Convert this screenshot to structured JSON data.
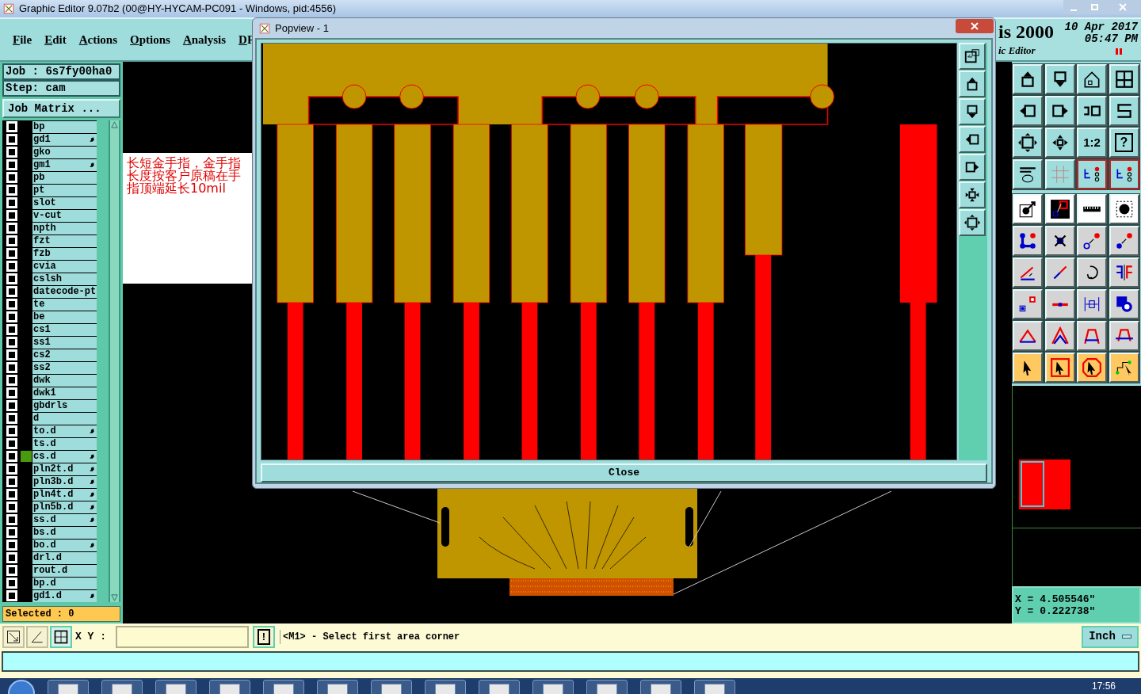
{
  "window": {
    "title": "Graphic Editor 9.07b2 (00@HY-HYCAM-PC091 - Windows, pid:4556)"
  },
  "menu": [
    "File",
    "Edit",
    "Actions",
    "Options",
    "Analysis",
    "DF"
  ],
  "header": {
    "product": "is 2000",
    "date": "10 Apr 2017",
    "time": "05:47 PM",
    "subtitle": "ic Editor"
  },
  "job": {
    "job_label": "Job : 6s7fy00ha0",
    "step_label": "Step: cam",
    "matrix_button": "Job Matrix ..."
  },
  "layers": [
    {
      "name": "bp",
      "checked": false,
      "marked": false,
      "highlighted": false
    },
    {
      "name": "gd1",
      "checked": false,
      "marked": true,
      "highlighted": false
    },
    {
      "name": "gko",
      "checked": false,
      "marked": false,
      "highlighted": false
    },
    {
      "name": "gm1",
      "checked": false,
      "marked": true,
      "highlighted": false
    },
    {
      "name": "pb",
      "checked": false,
      "marked": false,
      "highlighted": false
    },
    {
      "name": "pt",
      "checked": false,
      "marked": false,
      "highlighted": false
    },
    {
      "name": "slot",
      "checked": false,
      "marked": false,
      "highlighted": false
    },
    {
      "name": "v-cut",
      "checked": false,
      "marked": false,
      "highlighted": false
    },
    {
      "name": "npth",
      "checked": false,
      "marked": false,
      "highlighted": false
    },
    {
      "name": "fzt",
      "checked": false,
      "marked": false,
      "highlighted": false
    },
    {
      "name": "fzb",
      "checked": false,
      "marked": false,
      "highlighted": false
    },
    {
      "name": "cvia",
      "checked": false,
      "marked": false,
      "highlighted": false
    },
    {
      "name": "cslsh",
      "checked": false,
      "marked": false,
      "highlighted": false
    },
    {
      "name": "datecode-pt",
      "checked": false,
      "marked": false,
      "highlighted": false
    },
    {
      "name": "te",
      "checked": false,
      "marked": false,
      "highlighted": false
    },
    {
      "name": "be",
      "checked": false,
      "marked": false,
      "highlighted": false
    },
    {
      "name": "cs1",
      "checked": false,
      "marked": false,
      "highlighted": false
    },
    {
      "name": "ss1",
      "checked": false,
      "marked": false,
      "highlighted": false
    },
    {
      "name": "cs2",
      "checked": false,
      "marked": false,
      "highlighted": false
    },
    {
      "name": "ss2",
      "checked": false,
      "marked": false,
      "highlighted": false
    },
    {
      "name": "dwk",
      "checked": false,
      "marked": false,
      "highlighted": false
    },
    {
      "name": "dwk1",
      "checked": false,
      "marked": false,
      "highlighted": false
    },
    {
      "name": "gbdrls",
      "checked": false,
      "marked": false,
      "highlighted": false
    },
    {
      "name": "d",
      "checked": false,
      "marked": false,
      "highlighted": false
    },
    {
      "name": "to.d",
      "checked": false,
      "marked": true,
      "highlighted": false
    },
    {
      "name": "ts.d",
      "checked": false,
      "marked": false,
      "highlighted": false
    },
    {
      "name": "cs.d",
      "checked": false,
      "marked": true,
      "highlighted": true
    },
    {
      "name": "pln2t.d",
      "checked": false,
      "marked": true,
      "highlighted": false
    },
    {
      "name": "pln3b.d",
      "checked": false,
      "marked": true,
      "highlighted": false
    },
    {
      "name": "pln4t.d",
      "checked": false,
      "marked": true,
      "highlighted": false
    },
    {
      "name": "pln5b.d",
      "checked": false,
      "marked": true,
      "highlighted": false
    },
    {
      "name": "ss.d",
      "checked": false,
      "marked": true,
      "highlighted": false
    },
    {
      "name": "bs.d",
      "checked": false,
      "marked": false,
      "highlighted": false
    },
    {
      "name": "bo.d",
      "checked": false,
      "marked": true,
      "highlighted": false
    },
    {
      "name": "drl.d",
      "checked": false,
      "marked": false,
      "highlighted": false
    },
    {
      "name": "rout.d",
      "checked": false,
      "marked": false,
      "highlighted": false
    },
    {
      "name": "bp.d",
      "checked": false,
      "marked": false,
      "highlighted": false
    },
    {
      "name": "gd1.d",
      "checked": false,
      "marked": true,
      "highlighted": false
    }
  ],
  "selected_count": "Selected : 0",
  "note": "长短金手指，金手指长度按客户原稿在手指顶端延长10mil",
  "popview": {
    "title": "Popview - 1",
    "close_button": "Close"
  },
  "toolbar": {
    "ratio_label": "1:2",
    "help_label": "?",
    "net_tools": [
      {
        "on": true
      },
      {
        "on": true
      }
    ]
  },
  "coordinates": {
    "x": "X = 4.505546\"",
    "y": "Y = 0.222738\""
  },
  "command_bar": {
    "xy_label": "X Y :",
    "confirm_label": "!",
    "prompt": "<M1> - Select first area corner",
    "units": "Inch"
  },
  "taskbar": {
    "clock": "17:56"
  }
}
